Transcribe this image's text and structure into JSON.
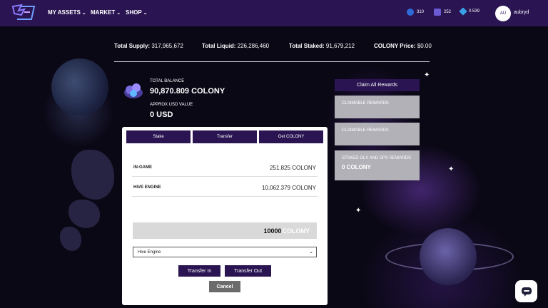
{
  "nav": {
    "items": [
      {
        "label": "MY ASSETS"
      },
      {
        "label": "MARKET"
      },
      {
        "label": "SHOP"
      }
    ],
    "stats": [
      {
        "value": "310",
        "icon": "plus-circle-icon",
        "color": "#6fa0ff"
      },
      {
        "value": "252",
        "icon": "wings-icon",
        "color": "#9a8cff"
      },
      {
        "value": "0.539",
        "icon": "diamond-icon",
        "color": "#5fb8ff"
      }
    ],
    "avatar_initials": "AU",
    "username": "aubryd"
  },
  "totals": {
    "supply_label": "Total Supply:",
    "supply_value": "317,965,672",
    "liquid_label": "Total Liquid:",
    "liquid_value": "226,286,460",
    "staked_label": "Total Staked:",
    "staked_value": "91,679,212",
    "price_label": "COLONY Price:",
    "price_value": "$0.00"
  },
  "balance": {
    "total_label": "TOTAL BALANCE",
    "total_value": "90,870.809 COLONY",
    "usd_label": "APPROX USD VALUE",
    "usd_value": "0 USD"
  },
  "rewards": {
    "claim_all_label": "Claim All Rewards",
    "cards": [
      {
        "label": "CLAIMABLE REWARDS",
        "value": ""
      },
      {
        "label": "CLAIMABLE REWARDS",
        "value": ""
      },
      {
        "label": "STAKED GLX AND SPS REWARDS",
        "value": "0 COLONY"
      }
    ]
  },
  "panel": {
    "tabs": [
      "Stake",
      "Transfer",
      "Get COLONY"
    ],
    "ingame_label": "IN-GAME",
    "ingame_value": "251.825 COLONY",
    "hive_label": "HIVE ENGINE",
    "hive_value": "10,062.379 COLONY",
    "amount_value": "10000",
    "amount_unit": "COLONY",
    "select_value": "Hive Engine",
    "transfer_in_label": "Transfer In",
    "transfer_out_label": "Transfer Out",
    "cancel_label": "Cancel"
  },
  "colors": {
    "nav_bg": "#2a1452",
    "button_bg": "#2a1452",
    "card_bg": "#b3b1b8"
  }
}
